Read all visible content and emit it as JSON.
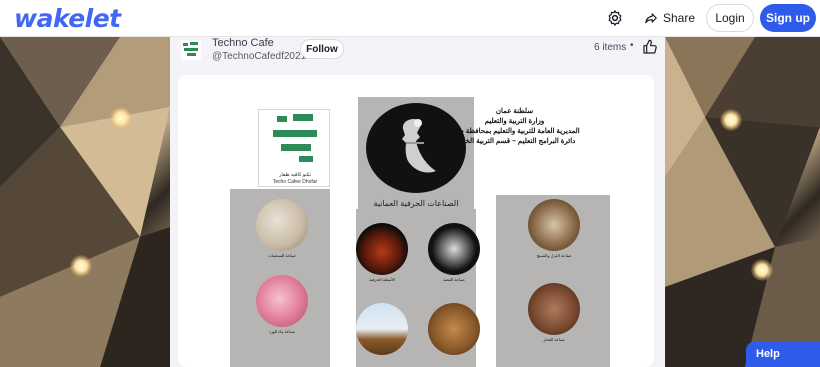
{
  "header": {
    "logo": "wakelet",
    "settings_icon": "gear-icon",
    "share_label": "Share",
    "login_label": "Login",
    "signup_label": "Sign up",
    "accent": "#2f5bea"
  },
  "author": {
    "name": "Techno Cafe",
    "handle": "@TechnoCafedf2021",
    "follow_label": "Follow",
    "items_count": "6 items",
    "separator": "•"
  },
  "poster": {
    "brand_line1": "تكنو كافيه ظفار",
    "brand_line2": "Techo Cafee Dhofar",
    "heading": [
      "سلطنة عمان",
      "وزارة التربية والتعليم",
      "المديرية العامة للتربية والتعليم بمحافظة ظفار",
      "دائرة البرامج التعليم – قسم التربية الخاصة"
    ],
    "crafts_title": "الصناعات الحرفية العمانية",
    "crafts": [
      {
        "caption": "صناعة السعفيات"
      },
      {
        "caption": "صناعة ماء الورد"
      },
      {
        "caption": "الأشغلة الحرفية"
      },
      {
        "caption": "صناعة الفضة"
      },
      {
        "caption": "صناعة الغزل والنسيج"
      },
      {
        "caption": "صناعة الفخار"
      }
    ]
  },
  "help_label": "Help"
}
